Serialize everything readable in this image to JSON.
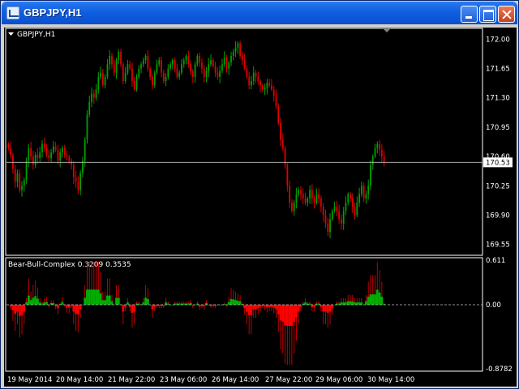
{
  "window": {
    "title": "GBPJPY,H1",
    "icon": "chart-window-icon",
    "buttons": {
      "minimize": "minimize-icon",
      "maximize": "maximize-icon",
      "close": "close-icon"
    }
  },
  "main_pane": {
    "label": "GBPJPY,H1",
    "current_price": "170.53",
    "price_ticks": [
      "172.00",
      "171.65",
      "171.30",
      "170.95",
      "170.60",
      "170.25",
      "169.90",
      "169.55"
    ],
    "colors": {
      "bull": "#00a000",
      "bear": "#e00000",
      "doji": "#ffffff",
      "price_line": "#c0c0c0"
    }
  },
  "indicator_pane": {
    "label": "Bear-Bull-Complex 0.3209 0.3535",
    "ticks": [
      "0.611",
      "0.00",
      "-0.8782"
    ],
    "colors": {
      "bull": "#00b000",
      "bear": "#ff0000",
      "hist": "#c00000"
    }
  },
  "time_axis": {
    "labels": [
      "19 May 2014",
      "20 May 14:00",
      "21 May 22:00",
      "23 May 06:00",
      "26 May 14:00",
      "27 May 22:00",
      "29 May 06:00",
      "30 May 14:00"
    ]
  },
  "chart_data": {
    "type": "candlestick",
    "symbol": "GBPJPY",
    "timeframe": "H1",
    "ylim": [
      169.45,
      172.1
    ],
    "close": [
      170.7,
      170.62,
      170.45,
      170.3,
      170.4,
      170.2,
      170.25,
      170.32,
      170.55,
      170.7,
      170.6,
      170.5,
      170.62,
      170.58,
      170.65,
      170.75,
      170.7,
      170.62,
      170.58,
      170.65,
      170.72,
      170.68,
      170.55,
      170.65,
      170.7,
      170.62,
      170.6,
      170.55,
      170.5,
      170.35,
      170.3,
      170.2,
      170.4,
      170.55,
      170.8,
      171.1,
      171.25,
      171.35,
      171.3,
      171.4,
      171.55,
      171.6,
      171.45,
      171.55,
      171.7,
      171.8,
      171.7,
      171.6,
      171.75,
      171.85,
      171.7,
      171.5,
      171.6,
      171.7,
      171.65,
      171.5,
      171.4,
      171.55,
      171.65,
      171.7,
      171.75,
      171.8,
      171.65,
      171.55,
      171.45,
      171.6,
      171.7,
      171.75,
      171.6,
      171.5,
      171.55,
      171.65,
      171.7,
      171.75,
      171.65,
      171.55,
      171.6,
      171.7,
      171.75,
      171.8,
      171.7,
      171.62,
      171.55,
      171.7,
      171.8,
      171.72,
      171.65,
      171.55,
      171.62,
      171.7,
      171.75,
      171.68,
      171.6,
      171.55,
      171.62,
      171.7,
      171.78,
      171.65,
      171.72,
      171.8,
      171.85,
      171.9,
      171.95,
      171.8,
      171.75,
      171.65,
      171.55,
      171.45,
      171.5,
      171.6,
      171.55,
      171.5,
      171.45,
      171.4,
      171.42,
      171.48,
      171.45,
      171.4,
      171.32,
      171.2,
      171.0,
      170.8,
      170.7,
      170.5,
      170.25,
      170.05,
      169.95,
      170.05,
      170.15,
      170.2,
      170.15,
      170.1,
      170.05,
      170.1,
      170.2,
      170.1,
      170.05,
      170.15,
      170.1,
      170.0,
      169.9,
      169.8,
      169.7,
      169.85,
      169.95,
      170.0,
      169.95,
      169.85,
      169.8,
      169.95,
      170.05,
      170.15,
      170.1,
      170.0,
      169.9,
      170.05,
      170.15,
      170.25,
      170.1,
      170.15,
      170.25,
      170.5,
      170.6,
      170.7,
      170.75,
      170.68,
      170.6,
      170.53
    ],
    "indicator": {
      "name": "Bear-Bull-Complex",
      "values_shown": [
        0.3209,
        0.3535
      ],
      "ylim": [
        -0.8782,
        0.611
      ]
    }
  }
}
